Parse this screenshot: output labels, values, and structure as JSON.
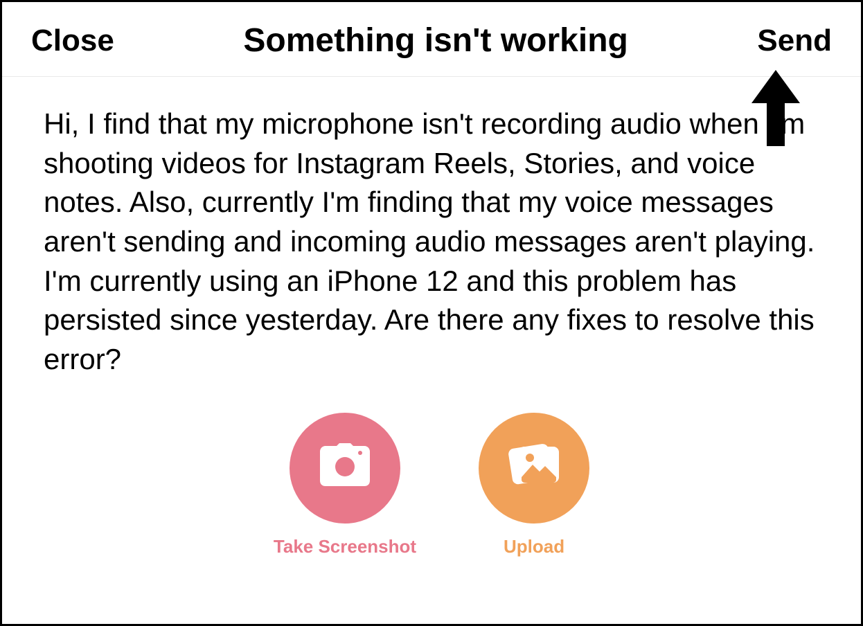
{
  "header": {
    "close_label": "Close",
    "title": "Something isn't working",
    "send_label": "Send"
  },
  "body": {
    "message": "Hi, I find that my microphone isn't recording audio when I'm shooting videos for Instagram Reels, Stories, and voice notes. Also, currently I'm finding that my voice messages aren't sending and incoming audio messages aren't playing. I'm currently using an iPhone 12 and this problem has persisted since yesterday. Are there any fixes to resolve this error?"
  },
  "actions": {
    "screenshot_label": "Take Screenshot",
    "upload_label": "Upload"
  },
  "colors": {
    "pink": "#e8788a",
    "orange": "#f1a159"
  }
}
